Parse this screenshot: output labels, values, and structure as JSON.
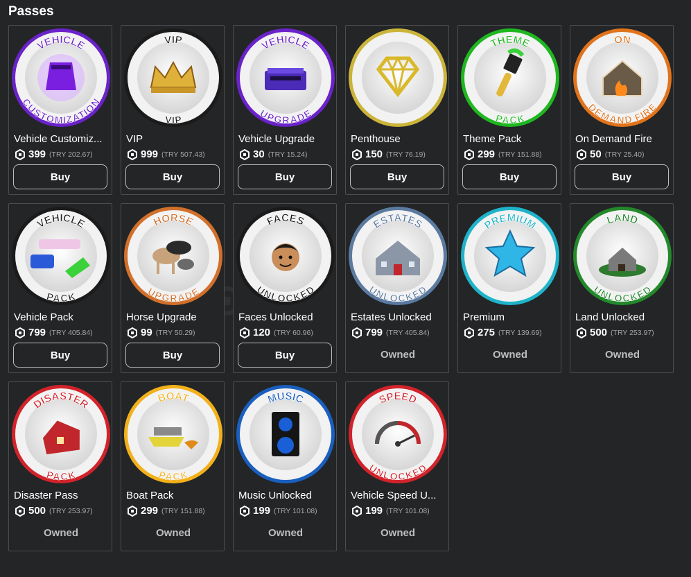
{
  "section_title": "Passes",
  "colors": {
    "background": "#232527",
    "card_border": "#4b4d50",
    "secondary_text": "#a4a6a8"
  },
  "passes": [
    {
      "name": "Vehicle Customiz...",
      "price": "399",
      "local_price": "(TRY 202.67)",
      "status": "buy",
      "action_label": "Buy",
      "ring_color": "#6a22c9",
      "badge_top": "VEHICLE",
      "badge_bottom": "CUSTOMIZATION",
      "art": "purple-car-icon"
    },
    {
      "name": "VIP",
      "price": "999",
      "local_price": "(TRY 507.43)",
      "status": "buy",
      "action_label": "Buy",
      "ring_color": "#1b1b1b",
      "badge_top": "VIP",
      "badge_bottom": "VIP",
      "art": "crown-icon"
    },
    {
      "name": "Vehicle Upgrade",
      "price": "30",
      "local_price": "(TRY 15.24)",
      "status": "buy",
      "action_label": "Buy",
      "ring_color": "#6a22c9",
      "badge_top": "VEHICLE",
      "badge_bottom": "UPGRADE",
      "art": "engine-box-icon"
    },
    {
      "name": "Penthouse",
      "price": "150",
      "local_price": "(TRY 76.19)",
      "status": "buy",
      "action_label": "Buy",
      "ring_color": "#cbb43a",
      "badge_top": "",
      "badge_bottom": "",
      "art": "diamond-icon"
    },
    {
      "name": "Theme Pack",
      "price": "299",
      "local_price": "(TRY 151.88)",
      "status": "buy",
      "action_label": "Buy",
      "ring_color": "#1fb71f",
      "badge_top": "THEME",
      "badge_bottom": "PACK",
      "art": "paintbrush-icon"
    },
    {
      "name": "On Demand Fire",
      "price": "50",
      "local_price": "(TRY 25.40)",
      "status": "buy",
      "action_label": "Buy",
      "ring_color": "#e0731b",
      "badge_top": "ON",
      "badge_bottom": "DEMAND FIRE",
      "art": "burning-house-icon"
    },
    {
      "name": "Vehicle Pack",
      "price": "799",
      "local_price": "(TRY 405.84)",
      "status": "buy",
      "action_label": "Buy",
      "ring_color": "#1b1b1b",
      "badge_top": "VEHICLE",
      "badge_bottom": "PACK",
      "art": "cars-icon"
    },
    {
      "name": "Horse Upgrade",
      "price": "99",
      "local_price": "(TRY 50.29)",
      "status": "buy",
      "action_label": "Buy",
      "ring_color": "#d2702b",
      "badge_top": "HORSE",
      "badge_bottom": "UPGRADE",
      "art": "horses-icon"
    },
    {
      "name": "Faces Unlocked",
      "price": "120",
      "local_price": "(TRY 60.96)",
      "status": "buy",
      "action_label": "Buy",
      "ring_color": "#1b1b1b",
      "badge_top": "FACES",
      "badge_bottom": "UNLOCKED",
      "art": "face-icon"
    },
    {
      "name": "Estates Unlocked",
      "price": "799",
      "local_price": "(TRY 405.84)",
      "status": "owned",
      "action_label": "Owned",
      "ring_color": "#5b7aa0",
      "badge_top": "ESTATES",
      "badge_bottom": "UNLOCKED",
      "art": "mansion-icon"
    },
    {
      "name": "Premium",
      "price": "275",
      "local_price": "(TRY 139.69)",
      "status": "owned",
      "action_label": "Owned",
      "ring_color": "#1fb3c9",
      "badge_top": "PREMIUM",
      "badge_bottom": "",
      "art": "star-icon"
    },
    {
      "name": "Land Unlocked",
      "price": "500",
      "local_price": "(TRY 253.97)",
      "status": "owned",
      "action_label": "Owned",
      "ring_color": "#23892b",
      "badge_top": "LAND",
      "badge_bottom": "UNLOCKED",
      "art": "land-house-icon"
    },
    {
      "name": "Disaster Pass",
      "price": "500",
      "local_price": "(TRY 253.97)",
      "status": "owned",
      "action_label": "Owned",
      "ring_color": "#d2232b",
      "badge_top": "DISASTER",
      "badge_bottom": "PACK",
      "art": "broken-house-icon"
    },
    {
      "name": "Boat Pack",
      "price": "299",
      "local_price": "(TRY 151.88)",
      "status": "owned",
      "action_label": "Owned",
      "ring_color": "#f2b11b",
      "badge_top": "BOAT",
      "badge_bottom": "PACK",
      "art": "boats-icon"
    },
    {
      "name": "Music Unlocked",
      "price": "199",
      "local_price": "(TRY 101.08)",
      "status": "owned",
      "action_label": "Owned",
      "ring_color": "#1a5fbf",
      "badge_top": "MUSIC",
      "badge_bottom": "",
      "art": "speaker-icon"
    },
    {
      "name": "Vehicle Speed U...",
      "price": "199",
      "local_price": "(TRY 101.08)",
      "status": "owned",
      "action_label": "Owned",
      "ring_color": "#d2232b",
      "badge_top": "SPEED",
      "badge_bottom": "UNLOCKED",
      "art": "speedometer-icon"
    }
  ]
}
